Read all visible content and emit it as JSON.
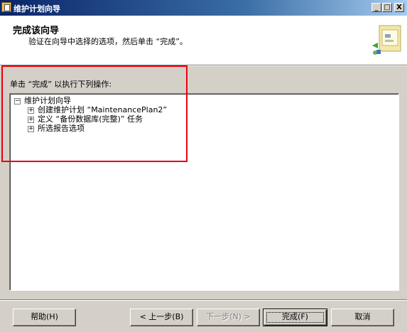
{
  "window": {
    "title": "维护计划向导",
    "buttons": {
      "minimize": "_",
      "maximize": "□",
      "close": "X"
    }
  },
  "header": {
    "title": "完成该向导",
    "subtitle": "验证在向导中选择的选项，然后单击 “完成”。"
  },
  "instruction": "单击 “完成” 以执行下列操作:",
  "tree": {
    "root": {
      "label": "维护计划向导",
      "expander": "−"
    },
    "children": [
      {
        "label": "创建维护计划 “MaintenancePlan2”",
        "expander": "+"
      },
      {
        "label": "定义 “备份数据库(完整)” 任务",
        "expander": "+"
      },
      {
        "label": "所选报告选项",
        "expander": "+"
      }
    ]
  },
  "buttons": {
    "help": "帮助(H)",
    "back": "< 上一步(B)",
    "next": "下一步(N) >",
    "finish": "完成(F)",
    "cancel": "取消"
  },
  "colors": {
    "title_bar_start": "#0a246a",
    "title_bar_end": "#a6caf0",
    "dialog_face": "#d4d0c8",
    "highlight_box": "#e8000f"
  },
  "icons": {
    "app": "wizard-app-icon",
    "header_art": "wizard-banner-graphic"
  }
}
